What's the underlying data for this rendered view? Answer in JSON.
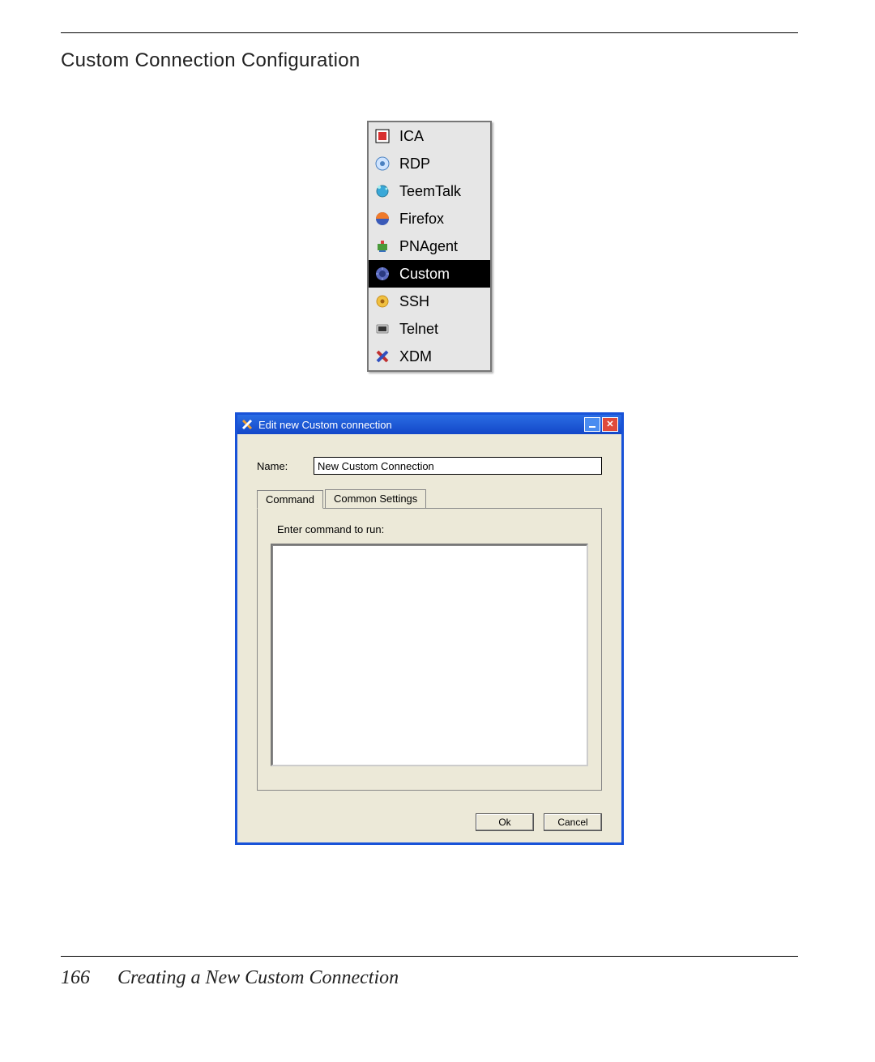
{
  "header": {
    "title": "Custom Connection Configuration"
  },
  "menu": {
    "items": [
      {
        "label": "ICA",
        "selected": false,
        "icon": "ica-icon"
      },
      {
        "label": "RDP",
        "selected": false,
        "icon": "rdp-icon"
      },
      {
        "label": "TeemTalk",
        "selected": false,
        "icon": "teemtalk-icon"
      },
      {
        "label": "Firefox",
        "selected": false,
        "icon": "firefox-icon"
      },
      {
        "label": "PNAgent",
        "selected": false,
        "icon": "pnagent-icon"
      },
      {
        "label": "Custom",
        "selected": true,
        "icon": "custom-icon"
      },
      {
        "label": "SSH",
        "selected": false,
        "icon": "ssh-icon"
      },
      {
        "label": "Telnet",
        "selected": false,
        "icon": "telnet-icon"
      },
      {
        "label": "XDM",
        "selected": false,
        "icon": "xdm-icon"
      }
    ]
  },
  "dialog": {
    "title": "Edit new Custom connection",
    "name_label": "Name:",
    "name_value": "New Custom Connection",
    "tabs": [
      {
        "label": "Command",
        "active": true
      },
      {
        "label": "Common Settings",
        "active": false
      }
    ],
    "command_hint": "Enter command to run:",
    "command_value": "",
    "ok_label": "Ok",
    "cancel_label": "Cancel"
  },
  "footer": {
    "page": "166",
    "chapter": "Creating a New Custom Connection"
  }
}
